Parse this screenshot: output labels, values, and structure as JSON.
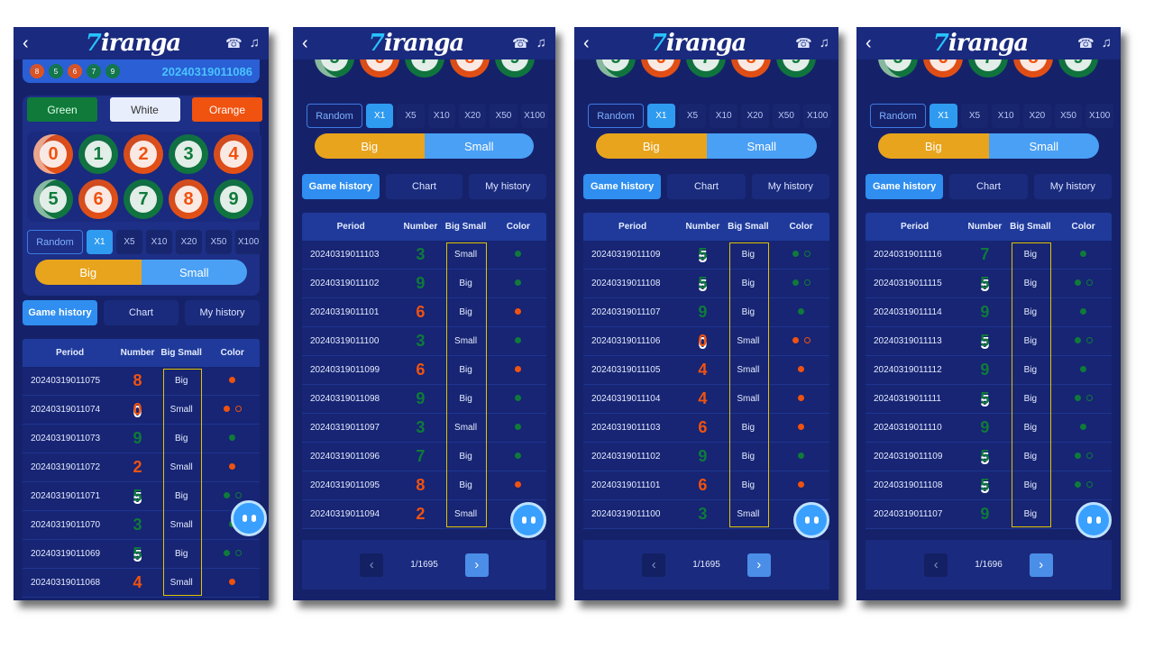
{
  "brand": {
    "logo": "Tiranga",
    "back_icon": "chevron-left-icon",
    "icons": [
      "customer-service-icon",
      "music-icon"
    ]
  },
  "colors": {
    "green": "#0f7a3a",
    "orange": "#f0520f",
    "white": "#e8eefc",
    "big": "#e8a41c",
    "small": "#4aa0f5",
    "accent": "#2f9bf0"
  },
  "labels": {
    "random": "Random",
    "multipliers": [
      "X1",
      "X5",
      "X10",
      "X20",
      "X50",
      "X100"
    ],
    "big": "Big",
    "small": "Small",
    "tabs": [
      "Game history",
      "Chart",
      "My history"
    ],
    "columns": [
      "Period",
      "Number",
      "Big Small",
      "Color"
    ]
  },
  "panels": [
    {
      "current_period": "20240319011086",
      "recent": [
        "8",
        "5",
        "6",
        "7",
        "9"
      ],
      "color_buttons": [
        "Green",
        "White",
        "Orange"
      ],
      "rows": [
        [
          "20240319011075",
          "8",
          "Big"
        ],
        [
          "20240319011074",
          "0",
          "Small"
        ],
        [
          "20240319011073",
          "9",
          "Big"
        ],
        [
          "20240319011072",
          "2",
          "Small"
        ],
        [
          "20240319011071",
          "5",
          "Big"
        ],
        [
          "20240319011070",
          "3",
          "Small"
        ],
        [
          "20240319011069",
          "5",
          "Big"
        ],
        [
          "20240319011068",
          "4",
          "Small"
        ]
      ]
    },
    {
      "page": "1/1695",
      "rows": [
        [
          "20240319011103",
          "3",
          "Small"
        ],
        [
          "20240319011102",
          "9",
          "Big"
        ],
        [
          "20240319011101",
          "6",
          "Big"
        ],
        [
          "20240319011100",
          "3",
          "Small"
        ],
        [
          "20240319011099",
          "6",
          "Big"
        ],
        [
          "20240319011098",
          "9",
          "Big"
        ],
        [
          "20240319011097",
          "3",
          "Small"
        ],
        [
          "20240319011096",
          "7",
          "Big"
        ],
        [
          "20240319011095",
          "8",
          "Big"
        ],
        [
          "20240319011094",
          "2",
          "Small"
        ]
      ]
    },
    {
      "page": "1/1695",
      "rows": [
        [
          "20240319011109",
          "5",
          "Big"
        ],
        [
          "20240319011108",
          "5",
          "Big"
        ],
        [
          "20240319011107",
          "9",
          "Big"
        ],
        [
          "20240319011106",
          "0",
          "Small"
        ],
        [
          "20240319011105",
          "4",
          "Small"
        ],
        [
          "20240319011104",
          "4",
          "Small"
        ],
        [
          "20240319011103",
          "6",
          "Big"
        ],
        [
          "20240319011102",
          "9",
          "Big"
        ],
        [
          "20240319011101",
          "6",
          "Big"
        ],
        [
          "20240319011100",
          "3",
          "Small"
        ]
      ]
    },
    {
      "page": "1/1696",
      "rows": [
        [
          "20240319011116",
          "7",
          "Big"
        ],
        [
          "20240319011115",
          "5",
          "Big"
        ],
        [
          "20240319011114",
          "9",
          "Big"
        ],
        [
          "20240319011113",
          "5",
          "Big"
        ],
        [
          "20240319011112",
          "9",
          "Big"
        ],
        [
          "20240319011111",
          "5",
          "Big"
        ],
        [
          "20240319011110",
          "9",
          "Big"
        ],
        [
          "20240319011109",
          "5",
          "Big"
        ],
        [
          "20240319011108",
          "5",
          "Big"
        ],
        [
          "20240319011107",
          "9",
          "Big"
        ]
      ]
    }
  ]
}
